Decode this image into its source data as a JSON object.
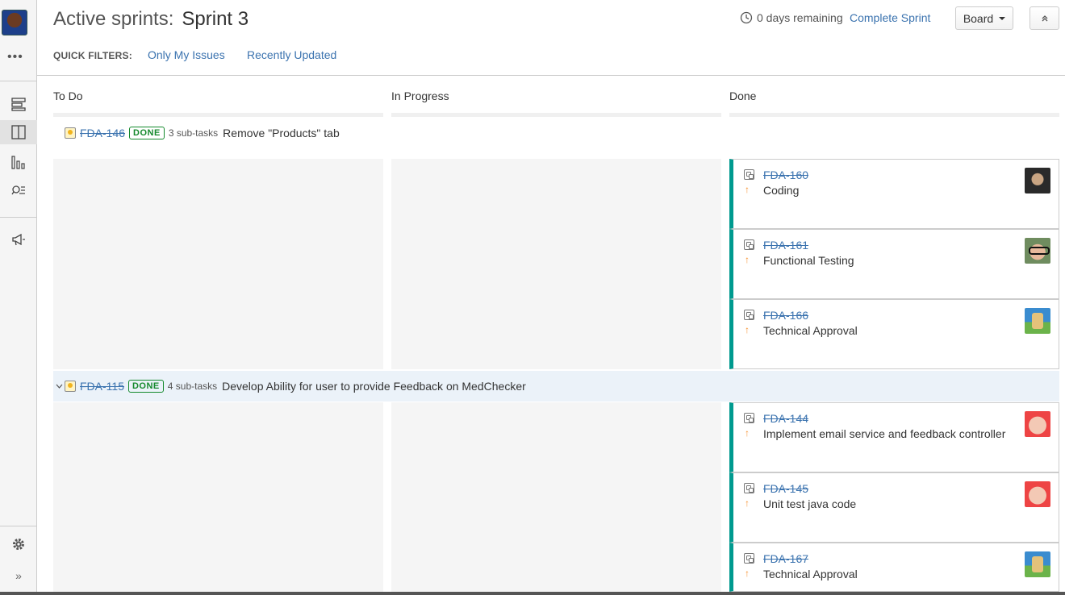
{
  "header": {
    "title_prefix": "Active sprints:",
    "sprint_name": "Sprint 3",
    "days_remaining": "0 days remaining",
    "complete_sprint": "Complete Sprint",
    "board_button": "Board"
  },
  "sidebar": {
    "more": "•••"
  },
  "quick_filters": {
    "label": "QUICK FILTERS:",
    "items": [
      "Only My Issues",
      "Recently Updated"
    ]
  },
  "columns": [
    "To Do",
    "In Progress",
    "Done"
  ],
  "swimlanes": [
    {
      "key": "FDA-146",
      "status": "DONE",
      "subtasks": "3 sub-tasks",
      "summary": "Remove \"Products\" tab",
      "cards": [
        {
          "key": "FDA-160",
          "summary": "Coding",
          "avatar": "dark"
        },
        {
          "key": "FDA-161",
          "summary": "Functional Testing",
          "avatar": "nerd"
        },
        {
          "key": "FDA-166",
          "summary": "Technical Approval",
          "avatar": "hat"
        }
      ]
    },
    {
      "key": "FDA-115",
      "status": "DONE",
      "subtasks": "4 sub-tasks",
      "summary": "Develop Ability for user to provide Feedback on MedChecker",
      "cards": [
        {
          "key": "FDA-144",
          "summary": "Implement email service and feedback controller",
          "avatar": "red"
        },
        {
          "key": "FDA-145",
          "summary": "Unit test java code",
          "avatar": "red"
        },
        {
          "key": "FDA-167",
          "summary": "Technical Approval",
          "avatar": "hat"
        }
      ]
    }
  ],
  "colors": {
    "link": "#3b73af",
    "done_green": "#14892c",
    "done_column_bar": "#009a8f",
    "priority": "#f79232"
  },
  "icons": [
    "avatar",
    "more-icon",
    "backlog-icon",
    "board-icon",
    "reports-icon",
    "issues-icon",
    "releases-icon",
    "settings-icon",
    "expand-sidebar-icon",
    "clock-icon",
    "story-icon",
    "subtask-icon",
    "priority-arrow-icon"
  ]
}
